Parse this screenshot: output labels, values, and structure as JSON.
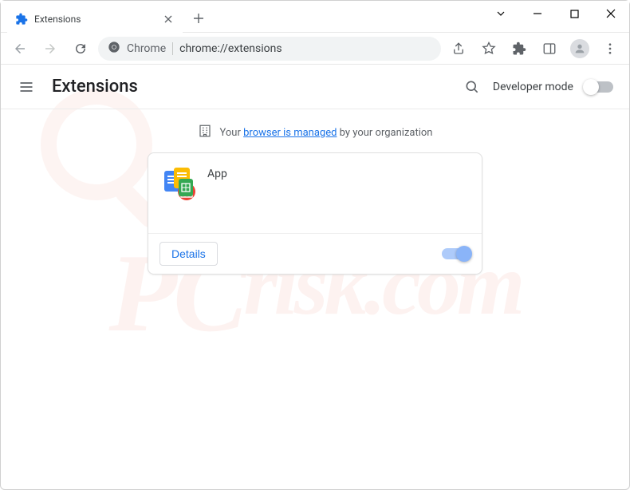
{
  "window": {
    "tab_title": "Extensions"
  },
  "omnibox": {
    "scheme_label": "Chrome",
    "url": "chrome://extensions"
  },
  "page": {
    "title": "Extensions",
    "developer_mode_label": "Developer mode",
    "developer_mode_on": false
  },
  "managed_banner": {
    "prefix": "Your ",
    "link_text": "browser is managed",
    "suffix": " by your organization"
  },
  "extensions": [
    {
      "name": "App",
      "details_label": "Details",
      "enabled": true
    }
  ],
  "watermark": {
    "text": "risk.com",
    "brand_prefix": "PC"
  }
}
